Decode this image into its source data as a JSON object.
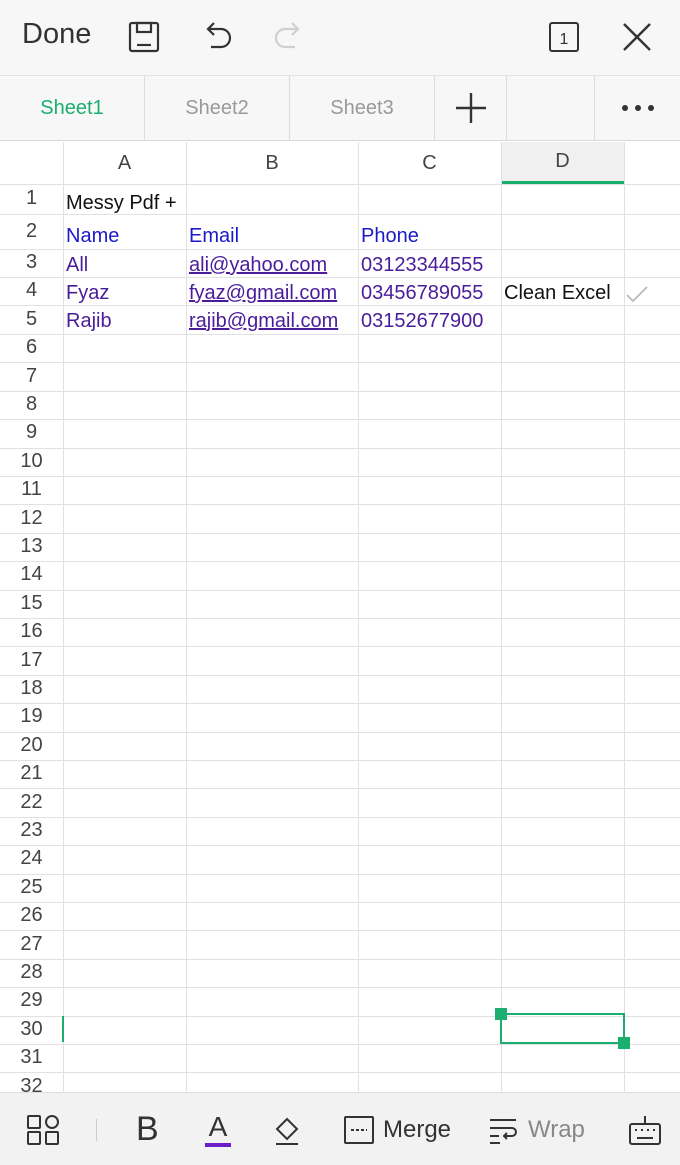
{
  "toolbar": {
    "done_label": "Done",
    "icons": [
      "save-icon",
      "undo-icon",
      "redo-icon",
      "page-count-icon",
      "close-icon"
    ],
    "page_count": "1"
  },
  "tabs": {
    "sheets": [
      "Sheet1",
      "Sheet2",
      "Sheet3"
    ],
    "active": "Sheet1"
  },
  "grid": {
    "columns": [
      "A",
      "B",
      "C",
      "D"
    ],
    "selected_column": "D",
    "rows": [
      "1",
      "2",
      "3",
      "4",
      "5",
      "6",
      "7",
      "8",
      "9",
      "10",
      "11",
      "12",
      "13",
      "14",
      "15",
      "16",
      "17",
      "18",
      "19",
      "20",
      "21",
      "22",
      "23",
      "24",
      "25",
      "26",
      "27",
      "28",
      "29",
      "30",
      "31",
      "32"
    ],
    "cells": {
      "A1": "Messy Pdf +",
      "A2": "Name",
      "B2": "Email",
      "C2": "Phone",
      "A3": "All",
      "B3": "ali@yahoo.com",
      "C3": "03123344555",
      "A4": "Fyaz",
      "B4": "fyaz@gmail.com",
      "C4": "03456789055",
      "D4": "Clean Excel",
      "A5": "Rajib",
      "B5": "rajib@gmail.com",
      "C5": "03152677900"
    },
    "selected_cell": "D30"
  },
  "bottombar": {
    "merge_label": "Merge",
    "wrap_label": "Wrap",
    "bold_label": "B",
    "font_color_label": "A"
  },
  "colors": {
    "accent": "#1aaf6f",
    "header_text": "#1a1acc",
    "value_text": "#4a1c9b",
    "font_color_bar": "#6a1fc9"
  }
}
